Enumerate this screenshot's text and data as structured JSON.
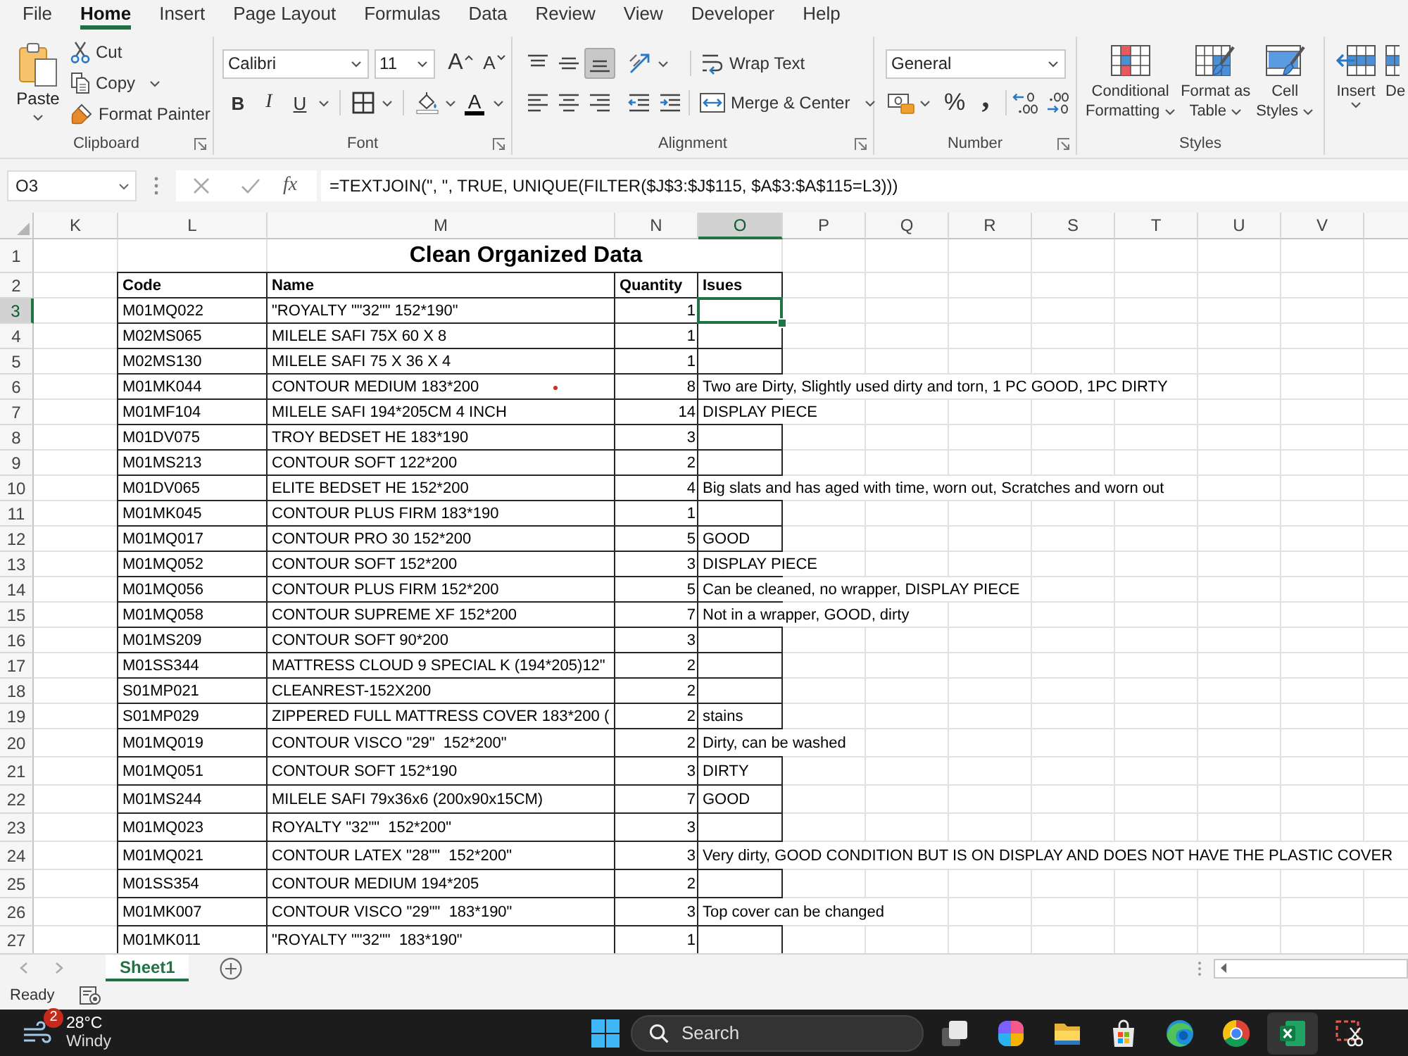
{
  "menu_tabs": [
    {
      "label": "File",
      "selected": false
    },
    {
      "label": "Home",
      "selected": true
    },
    {
      "label": "Insert",
      "selected": false
    },
    {
      "label": "Page Layout",
      "selected": false
    },
    {
      "label": "Formulas",
      "selected": false
    },
    {
      "label": "Data",
      "selected": false
    },
    {
      "label": "Review",
      "selected": false
    },
    {
      "label": "View",
      "selected": false
    },
    {
      "label": "Developer",
      "selected": false
    },
    {
      "label": "Help",
      "selected": false
    }
  ],
  "ribbon": {
    "clipboard": {
      "label": "Clipboard",
      "paste": "Paste",
      "cut": "Cut",
      "copy": "Copy",
      "format_painter": "Format Painter"
    },
    "font": {
      "label": "Font",
      "font_name": "Calibri",
      "font_size": "11",
      "grow_font": "A",
      "shrink_font": "A",
      "bold": "B",
      "italic": "I",
      "underline": "U",
      "font_color": "A"
    },
    "alignment": {
      "label": "Alignment",
      "vertical": [
        {
          "kind": "top",
          "selected": false
        },
        {
          "kind": "middle",
          "selected": false
        },
        {
          "kind": "bottom",
          "selected": true
        }
      ],
      "horizontal": [
        {
          "kind": "left",
          "selected": false
        },
        {
          "kind": "center",
          "selected": false
        },
        {
          "kind": "right",
          "selected": false
        }
      ],
      "wrap_text": "Wrap Text",
      "merge_center": "Merge & Center"
    },
    "number": {
      "label": "Number",
      "format": "General",
      "percent": "%",
      "comma": ","
    },
    "styles": {
      "label": "Styles",
      "buttons": [
        {
          "kind": "conditional",
          "lines": [
            "Conditional",
            "Formatting"
          ]
        },
        {
          "kind": "table",
          "lines": [
            "Format as",
            "Table"
          ]
        },
        {
          "kind": "cell",
          "lines": [
            "Cell",
            "Styles"
          ]
        }
      ]
    },
    "cells": {
      "buttons": [
        {
          "kind": "insert",
          "label": "Insert"
        },
        {
          "kind": "delete",
          "label": "De"
        }
      ]
    }
  },
  "formula_bar": {
    "name_box": "O3",
    "function_label": "fx",
    "formula": "=TEXTJOIN(\", \", TRUE, UNIQUE(FILTER($J$3:$J$115, $A$3:$A$115=L3)))"
  },
  "sheet": {
    "columns": [
      {
        "label": "K",
        "selected": false
      },
      {
        "label": "L",
        "selected": false
      },
      {
        "label": "M",
        "selected": false
      },
      {
        "label": "N",
        "selected": false
      },
      {
        "label": "O",
        "selected": true
      },
      {
        "label": "P",
        "selected": false
      },
      {
        "label": "Q",
        "selected": false
      },
      {
        "label": "R",
        "selected": false
      },
      {
        "label": "S",
        "selected": false
      },
      {
        "label": "T",
        "selected": false
      },
      {
        "label": "U",
        "selected": false
      },
      {
        "label": "V",
        "selected": false
      }
    ],
    "title_row": {
      "row": "1",
      "selected": false,
      "title": "Clean Organized Data"
    },
    "header_row": {
      "row": "2",
      "selected": false,
      "cells": [
        "Code",
        "Name",
        "Quantity",
        "Isues"
      ]
    },
    "rows": [
      {
        "row": "3",
        "selected": true,
        "marked": false,
        "code": "M01MQ022",
        "name": "\"ROYALTY \"\"32\"\" 152*190\"",
        "quantity": "1"
      },
      {
        "row": "4",
        "selected": false,
        "marked": false,
        "code": "M02MS065",
        "name": "MILELE SAFI 75X 60 X 8",
        "quantity": "1"
      },
      {
        "row": "5",
        "selected": false,
        "marked": false,
        "code": "M02MS130",
        "name": "MILELE SAFI 75 X 36 X 4",
        "quantity": "1"
      },
      {
        "row": "6",
        "selected": false,
        "marked": true,
        "code": "M01MK044",
        "name": "CONTOUR MEDIUM 183*200",
        "quantity": "8",
        "issues": "Two are Dirty, Slightly used dirty and torn, 1 PC GOOD, 1PC DIRTY"
      },
      {
        "row": "7",
        "selected": false,
        "marked": false,
        "code": "M01MF104",
        "name": "MILELE SAFI 194*205CM 4 INCH",
        "quantity": "14",
        "issues": "DISPLAY PIECE"
      },
      {
        "row": "8",
        "selected": false,
        "marked": false,
        "code": "M01DV075",
        "name": "TROY BEDSET HE 183*190",
        "quantity": "3"
      },
      {
        "row": "9",
        "selected": false,
        "marked": false,
        "code": "M01MS213",
        "name": "CONTOUR SOFT 122*200",
        "quantity": "2"
      },
      {
        "row": "10",
        "selected": false,
        "marked": false,
        "code": "M01DV065",
        "name": "ELITE BEDSET HE 152*200",
        "quantity": "4",
        "issues": "Big slats and has aged with time, worn out, Scratches and worn out"
      },
      {
        "row": "11",
        "selected": false,
        "marked": false,
        "code": "M01MK045",
        "name": "CONTOUR PLUS FIRM 183*190",
        "quantity": "1"
      },
      {
        "row": "12",
        "selected": false,
        "marked": false,
        "code": "M01MQ017",
        "name": "CONTOUR PRO 30 152*200",
        "quantity": "5",
        "issues": "GOOD"
      },
      {
        "row": "13",
        "selected": false,
        "marked": false,
        "code": "M01MQ052",
        "name": "CONTOUR SOFT 152*200",
        "quantity": "3",
        "issues": "DISPLAY PIECE"
      },
      {
        "row": "14",
        "selected": false,
        "marked": false,
        "code": "M01MQ056",
        "name": "CONTOUR PLUS FIRM 152*200",
        "quantity": "5",
        "issues": "Can be cleaned, no wrapper, DISPLAY PIECE"
      },
      {
        "row": "15",
        "selected": false,
        "marked": false,
        "code": "M01MQ058",
        "name": "CONTOUR SUPREME XF 152*200",
        "quantity": "7",
        "issues": "Not in a wrapper, GOOD, dirty"
      },
      {
        "row": "16",
        "selected": false,
        "marked": false,
        "code": "M01MS209",
        "name": "CONTOUR SOFT 90*200",
        "quantity": "3"
      },
      {
        "row": "17",
        "selected": false,
        "marked": false,
        "code": "M01SS344",
        "name": "MATTRESS CLOUD 9 SPECIAL K (194*205)12\"",
        "quantity": "2"
      },
      {
        "row": "18",
        "selected": false,
        "marked": false,
        "code": "S01MP021",
        "name": "CLEANREST-152X200",
        "quantity": "2"
      },
      {
        "row": "19",
        "selected": false,
        "marked": false,
        "code": "S01MP029",
        "name": "ZIPPERED FULL MATTRESS COVER 183*200 (",
        "quantity": "2",
        "issues": "stains"
      },
      {
        "row": "20",
        "selected": false,
        "marked": false,
        "code": "M01MQ019",
        "name": "CONTOUR VISCO \"29\"  152*200\"",
        "quantity": "2",
        "issues": "Dirty, can be washed"
      },
      {
        "row": "21",
        "selected": false,
        "marked": false,
        "code": "M01MQ051",
        "name": "CONTOUR SOFT 152*190",
        "quantity": "3",
        "issues": "DIRTY"
      },
      {
        "row": "22",
        "selected": false,
        "marked": false,
        "code": "M01MS244",
        "name": "MILELE SAFI 79x36x6 (200x90x15CM)",
        "quantity": "7",
        "issues": "GOOD"
      },
      {
        "row": "23",
        "selected": false,
        "marked": false,
        "code": "M01MQ023",
        "name": "ROYALTY \"32\"\"  152*200\"",
        "quantity": "3"
      },
      {
        "row": "24",
        "selected": false,
        "marked": false,
        "code": "M01MQ021",
        "name": "CONTOUR LATEX \"28\"\"  152*200\"",
        "quantity": "3",
        "issues": "Very dirty, GOOD CONDITION BUT IS ON DISPLAY AND DOES NOT HAVE THE PLASTIC COVER"
      },
      {
        "row": "25",
        "selected": false,
        "marked": false,
        "code": "M01SS354",
        "name": "CONTOUR MEDIUM 194*205",
        "quantity": "2"
      },
      {
        "row": "26",
        "selected": false,
        "marked": false,
        "code": "M01MK007",
        "name": "CONTOUR VISCO \"29\"\"  183*190\"",
        "quantity": "3",
        "issues": "Top cover can be changed"
      },
      {
        "row": "27",
        "selected": false,
        "marked": false,
        "code": "M01MK011",
        "name": "\"ROYALTY \"\"32\"\"  183*190\"",
        "quantity": "1"
      }
    ]
  },
  "sheet_tabs": [
    {
      "label": "Sheet1",
      "selected": true
    }
  ],
  "status_bar": {
    "status": "Ready"
  },
  "taskbar": {
    "weather": {
      "badge": "2",
      "temperature": "28°C",
      "condition": "Windy"
    },
    "search": {
      "label": "Search"
    },
    "apps": [
      {
        "kind": "task_view",
        "active": false
      },
      {
        "kind": "suite",
        "active": false
      },
      {
        "kind": "files",
        "active": false
      },
      {
        "kind": "store",
        "active": false
      },
      {
        "kind": "browser",
        "active": false
      },
      {
        "kind": "web",
        "active": false
      },
      {
        "kind": "spreadsheet",
        "active": true
      },
      {
        "kind": "snip",
        "active": false
      }
    ]
  }
}
